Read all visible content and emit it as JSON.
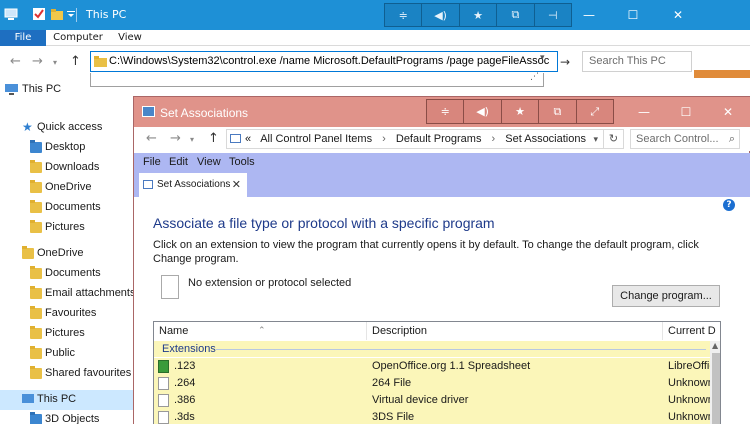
{
  "explorer": {
    "title": "This PC",
    "ribbon_tabs": [
      "File",
      "Computer",
      "View"
    ],
    "address": "C:\\Windows\\System32\\control.exe /name Microsoft.DefaultPrograms /page pageFileAssoc",
    "search_placeholder": "Search This PC",
    "breadcrumb": "This PC",
    "nav": [
      {
        "label": "Quick access",
        "icon": "star-icon",
        "indent": 0
      },
      {
        "label": "Desktop",
        "icon": "folder-blue-icon",
        "indent": 1
      },
      {
        "label": "Downloads",
        "icon": "folder-icon",
        "indent": 1
      },
      {
        "label": "OneDrive",
        "icon": "folder-icon",
        "indent": 1
      },
      {
        "label": "Documents",
        "icon": "folder-icon",
        "indent": 1
      },
      {
        "label": "Pictures",
        "icon": "folder-icon",
        "indent": 1
      },
      {
        "label": "OneDrive",
        "icon": "folder-icon",
        "indent": 0
      },
      {
        "label": "Documents",
        "icon": "folder-icon",
        "indent": 1
      },
      {
        "label": "Email attachments",
        "icon": "folder-icon",
        "indent": 1
      },
      {
        "label": "Favourites",
        "icon": "folder-icon",
        "indent": 1
      },
      {
        "label": "Pictures",
        "icon": "folder-icon",
        "indent": 1
      },
      {
        "label": "Public",
        "icon": "folder-icon",
        "indent": 1
      },
      {
        "label": "Shared favourites",
        "icon": "folder-icon",
        "indent": 1
      },
      {
        "label": "This PC",
        "icon": "computer-icon",
        "indent": 0,
        "selected": true
      },
      {
        "label": "3D Objects",
        "icon": "folder-blue-icon",
        "indent": 1
      }
    ]
  },
  "assoc": {
    "title": "Set Associations",
    "breadcrumb": [
      "«",
      "All Control Panel Items",
      "Default Programs",
      "Set Associations"
    ],
    "search_placeholder": "Search Control...",
    "menu": [
      "File",
      "Edit",
      "View",
      "Tools"
    ],
    "tab_label": "Set Associations",
    "heading": "Associate a file type or protocol with a specific program",
    "description": "Click on an extension to view the program that currently opens it by default. To change the default program, click Change program.",
    "no_selection": "No extension or protocol selected",
    "change_button": "Change program...",
    "columns": [
      "Name",
      "Description",
      "Current D"
    ],
    "group_label": "Extensions",
    "rows": [
      {
        "name": ".123",
        "description": "OpenOffice.org 1.1 Spreadsheet",
        "current": "LibreOffic",
        "icon": "spreadsheet-icon"
      },
      {
        "name": ".264",
        "description": "264 File",
        "current": "Unknown",
        "icon": "file-icon"
      },
      {
        "name": ".386",
        "description": "Virtual device driver",
        "current": "Unknown",
        "icon": "file-icon"
      },
      {
        "name": ".3ds",
        "description": "3DS File",
        "current": "Unknown",
        "icon": "file-icon"
      }
    ]
  },
  "colors": {
    "explorer_titlebar": "#1e90d6",
    "assoc_titlebar": "#e0938a",
    "menu_band": "#adb7f2",
    "list_highlight": "#fbf6b9",
    "heading": "#1e3a8a"
  }
}
